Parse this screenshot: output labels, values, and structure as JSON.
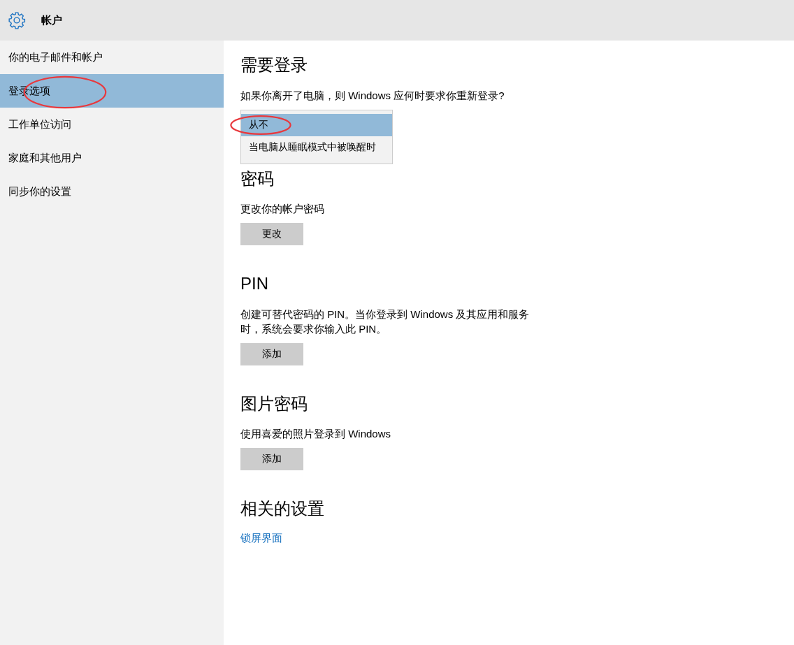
{
  "header": {
    "title": "帐户"
  },
  "sidebar": {
    "items": [
      {
        "label": "你的电子邮件和帐户",
        "selected": false,
        "circled": false
      },
      {
        "label": "登录选项",
        "selected": true,
        "circled": true
      },
      {
        "label": "工作单位访问",
        "selected": false,
        "circled": false
      },
      {
        "label": "家庭和其他用户",
        "selected": false,
        "circled": false
      },
      {
        "label": "同步你的设置",
        "selected": false,
        "circled": false
      }
    ]
  },
  "sections": [
    {
      "kind": "dropdown",
      "heading": "需要登录",
      "description": "如果你离开了电脑，则 Windows 应何时要求你重新登录?",
      "options": [
        {
          "label": "从不",
          "selected": true,
          "circled": true
        },
        {
          "label": "当电脑从睡眠模式中被唤醒时",
          "selected": false,
          "circled": false
        }
      ]
    },
    {
      "kind": "button",
      "heading": "密码",
      "description": "更改你的帐户密码",
      "button": "更改"
    },
    {
      "kind": "button",
      "heading": "PIN",
      "description": "创建可替代密码的 PIN。当你登录到 Windows 及其应用和服务时，系统会要求你输入此 PIN。",
      "button": "添加"
    },
    {
      "kind": "button",
      "heading": "图片密码",
      "description": "使用喜爱的照片登录到 Windows",
      "button": "添加"
    },
    {
      "kind": "link",
      "heading": "相关的设置",
      "link": "锁屏界面"
    }
  ]
}
